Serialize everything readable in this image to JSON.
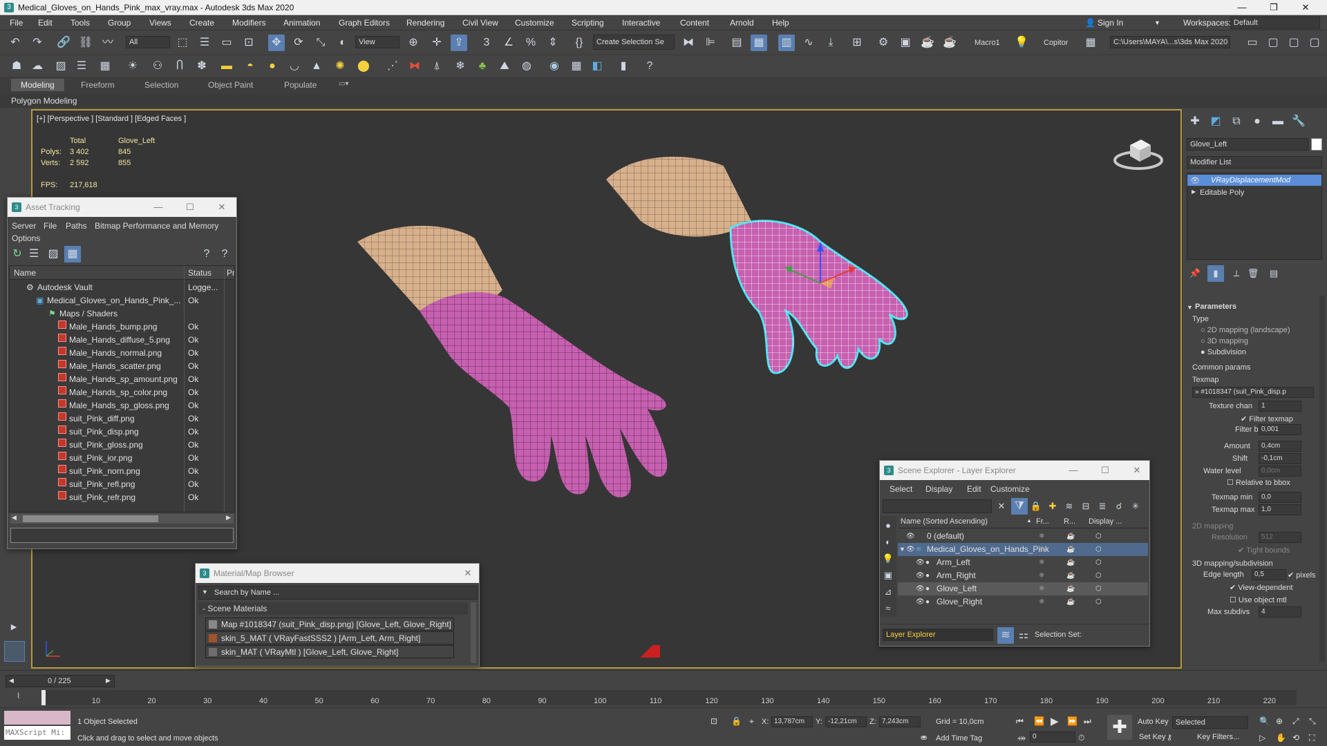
{
  "title": "Medical_Gloves_on_Hands_Pink_max_vray.max - Autodesk 3ds Max 2020",
  "menu": [
    "File",
    "Edit",
    "Tools",
    "Group",
    "Views",
    "Create",
    "Modifiers",
    "Animation",
    "Graph Editors",
    "Rendering",
    "Civil View",
    "Customize",
    "Scripting",
    "Interactive",
    "Content",
    "Arnold",
    "Help"
  ],
  "account": {
    "sign_in": "Sign In",
    "workspaces_label": "Workspaces:",
    "workspace": "Default"
  },
  "toolbar": {
    "filter": "All",
    "view": "View",
    "create_selection": "Create Selection Se",
    "macro": "Macro1",
    "copitor": "Copitor",
    "path": "C:\\Users\\MAYA\\...s\\3ds Max 2020"
  },
  "ribbon": {
    "tabs": [
      "Modeling",
      "Freeform",
      "Selection",
      "Object Paint",
      "Populate"
    ],
    "sub": "Polygon Modeling"
  },
  "viewport": {
    "label": "[+] [Perspective ] [Standard ] [Edged Faces ]",
    "stats": {
      "total_label": "Total",
      "object_label": "Glove_Left",
      "polys_label": "Polys:",
      "verts_label": "Verts:",
      "polys_total": "3 402",
      "polys_obj": "845",
      "verts_total": "2 592",
      "verts_obj": "855",
      "fps_label": "FPS:",
      "fps": "217,618"
    }
  },
  "asset_tracking": {
    "title": "Asset Tracking",
    "menu": [
      "Server",
      "File",
      "Paths",
      "Bitmap Performance and Memory"
    ],
    "menu2": "Options",
    "columns": [
      "Name",
      "Status",
      "Pr"
    ],
    "rows": [
      {
        "name": "Autodesk Vault",
        "status": "Logge..."
      },
      {
        "name": "Medical_Gloves_on_Hands_Pink_...",
        "status": "Ok"
      },
      {
        "name": "Maps / Shaders",
        "status": ""
      },
      {
        "name": "Male_Hands_bump.png",
        "status": "Ok"
      },
      {
        "name": "Male_Hands_diffuse_5.png",
        "status": "Ok"
      },
      {
        "name": "Male_Hands_normal.png",
        "status": "Ok"
      },
      {
        "name": "Male_Hands_scatter.png",
        "status": "Ok"
      },
      {
        "name": "Male_Hands_sp_amount.png",
        "status": "Ok"
      },
      {
        "name": "Male_Hands_sp_color.png",
        "status": "Ok"
      },
      {
        "name": "Male_Hands_sp_gloss.png",
        "status": "Ok"
      },
      {
        "name": "suit_Pink_diff.png",
        "status": "Ok"
      },
      {
        "name": "suit_Pink_disp.png",
        "status": "Ok"
      },
      {
        "name": "suit_Pink_gloss.png",
        "status": "Ok"
      },
      {
        "name": "suit_Pink_ior.png",
        "status": "Ok"
      },
      {
        "name": "suit_Pink_norn.png",
        "status": "Ok"
      },
      {
        "name": "suit_Pink_refl.png",
        "status": "Ok"
      },
      {
        "name": "suit_Pink_refr.png",
        "status": "Ok"
      }
    ]
  },
  "material_browser": {
    "title": "Material/Map Browser",
    "search_placeholder": "Search by Name ...",
    "group": "- Scene Materials",
    "items": [
      "Map #1018347 (suit_Pink_disp.png) [Glove_Left, Glove_Right]",
      "skin_5_MAT  ( VRayFastSSS2 ) [Arm_Left, Arm_Right]",
      "skin_MAT  ( VRayMtl ) [Glove_Left, Glove_Right]"
    ]
  },
  "scene_explorer": {
    "title": "Scene Explorer - Layer Explorer",
    "menu": [
      "Select",
      "Display",
      "Edit",
      "Customize"
    ],
    "columns": [
      "Name (Sorted Ascending)",
      "Fr...",
      "R...",
      "Display ..."
    ],
    "rows": [
      "0 (default)",
      "Medical_Gloves_on_Hands_Pink",
      "Arm_Left",
      "Arm_Right",
      "Glove_Left",
      "Glove_Right"
    ],
    "footer_dd": "Layer Explorer",
    "selection_set": "Selection Set:"
  },
  "command_panel": {
    "object_name": "Glove_Left",
    "modifier_list": "Modifier List",
    "stack": [
      "VRayDisplacementMod",
      "Editable Poly"
    ],
    "parameters": "Parameters",
    "type_label": "Type",
    "types": [
      "2D mapping (landscape)",
      "3D mapping",
      "Subdivision"
    ],
    "common": "Common params",
    "texmap": "Texmap",
    "texmap_value": "» #1018347 (suit_Pink_disp.p",
    "texture_chan_label": "Texture chan",
    "texture_chan": "1",
    "filter_texmap": "Filter texmap",
    "filter_blur_label": "Filter blur",
    "filter_blur": "0,001",
    "amount_label": "Amount",
    "amount": "0,4cm",
    "shift_label": "Shift",
    "shift": "-0,1cm",
    "water_label": "Water level",
    "water": "0,0cm",
    "relative": "Relative to bbox",
    "texmap_min_label": "Texmap min",
    "texmap_min": "0,0",
    "texmap_max_label": "Texmap max",
    "texmap_max": "1,0",
    "map2d": "2D mapping",
    "resolution_label": "Resolution",
    "resolution": "512",
    "tight": "Tight bounds",
    "map3d": "3D mapping/subdivision",
    "edge_label": "Edge length",
    "edge": "0,5",
    "pixels": "pixels",
    "view_dep": "View-dependent",
    "use_obj": "Use object mtl",
    "max_subdivs_label": "Max subdivs",
    "max_subdivs": "4"
  },
  "timeline": {
    "frame": "0 / 225",
    "ticks": [
      "10",
      "20",
      "30",
      "40",
      "50",
      "60",
      "70",
      "80",
      "90",
      "100",
      "110",
      "120",
      "130",
      "140",
      "150",
      "160",
      "170",
      "180",
      "190",
      "200",
      "210",
      "220"
    ]
  },
  "status": {
    "maxscript": "MAXScript Mi:",
    "selected": "1 Object Selected",
    "prompt": "Click and drag to select and move objects",
    "x_label": "X:",
    "x": "13,787cm",
    "y_label": "Y:",
    "y": "-12,21cm",
    "z_label": "Z:",
    "z": "7,243cm",
    "grid": "Grid = 10,0cm",
    "add_time_tag": "Add Time Tag",
    "auto_key": "Auto Key",
    "selected_dd": "Selected",
    "set_key": "Set Key",
    "key_filters": "Key Filters...",
    "frame": "0"
  },
  "colors": {
    "glove": "#c760b0",
    "skin": "#d7b08c",
    "selection": "#4fe3f0",
    "viewport_border": "#b89b3a",
    "selected_mod": "#5b8ed8"
  }
}
